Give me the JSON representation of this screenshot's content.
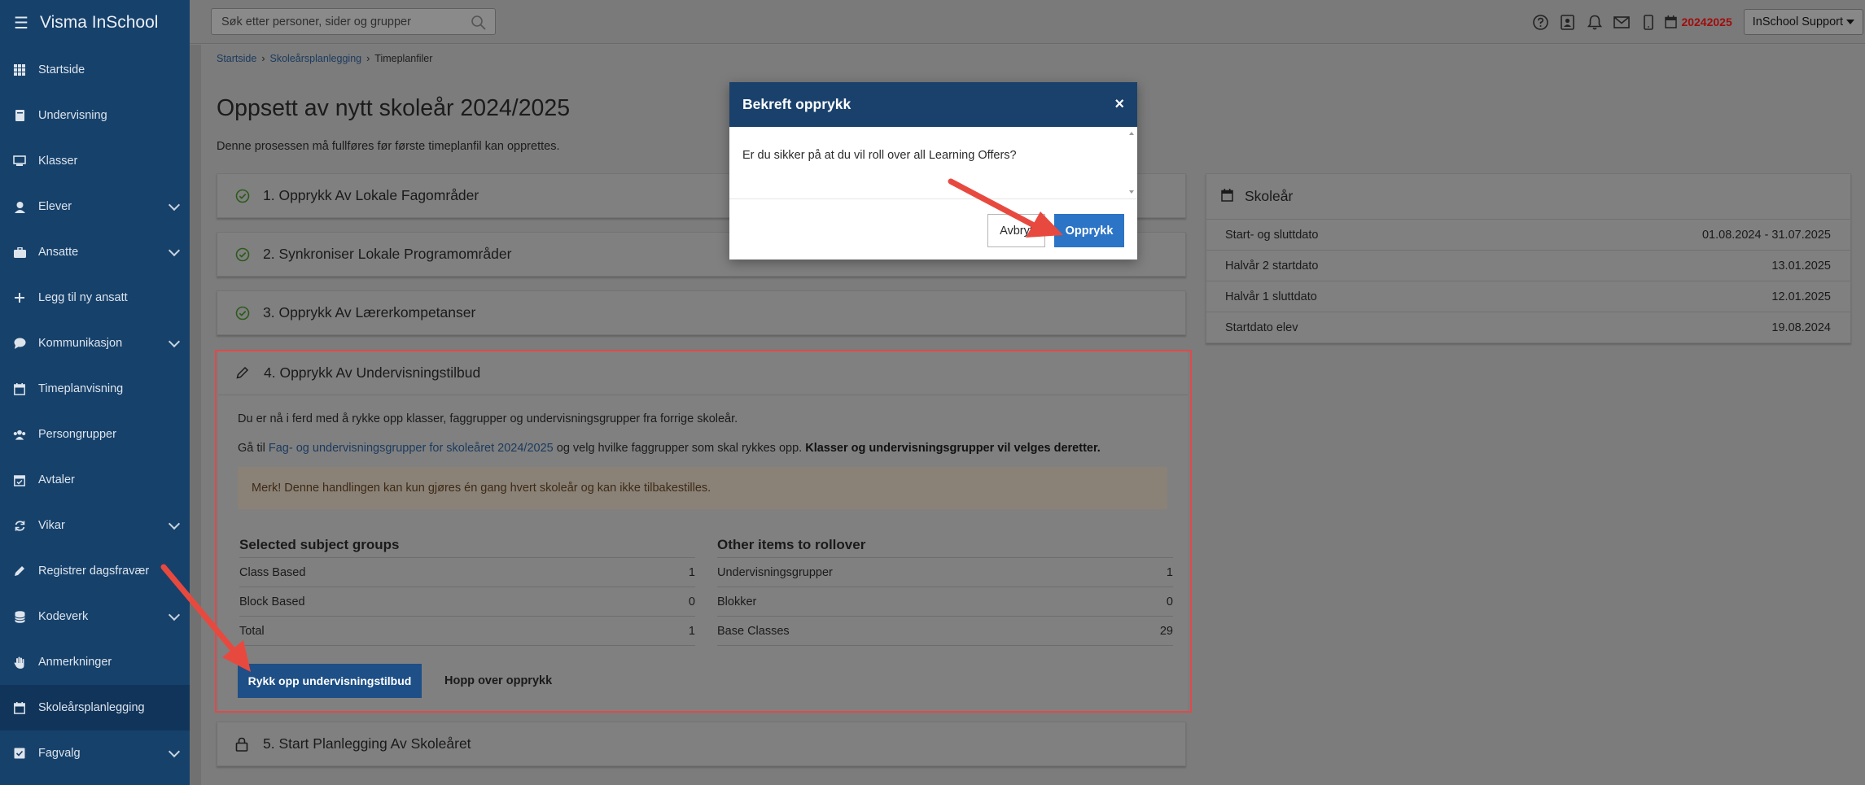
{
  "app": {
    "title": "Visma InSchool"
  },
  "sidebar": {
    "items": [
      {
        "label": "Startside",
        "icon": "grid-icon"
      },
      {
        "label": "Undervisning",
        "icon": "book-icon"
      },
      {
        "label": "Klasser",
        "icon": "presentation-icon"
      },
      {
        "label": "Elever",
        "icon": "student-icon",
        "expandable": true
      },
      {
        "label": "Ansatte",
        "icon": "briefcase-icon",
        "expandable": true
      },
      {
        "label": "Legg til ny ansatt",
        "icon": "plus-icon"
      },
      {
        "label": "Kommunikasjon",
        "icon": "chat-icon",
        "expandable": true
      },
      {
        "label": "Timeplanvisning",
        "icon": "calendar-icon"
      },
      {
        "label": "Persongrupper",
        "icon": "users-icon"
      },
      {
        "label": "Avtaler",
        "icon": "calendar-check-icon"
      },
      {
        "label": "Vikar",
        "icon": "refresh-icon",
        "expandable": true
      },
      {
        "label": "Registrer dagsfravær",
        "icon": "pencil-icon"
      },
      {
        "label": "Kodeverk",
        "icon": "database-icon",
        "expandable": true
      },
      {
        "label": "Anmerkninger",
        "icon": "hand-icon"
      },
      {
        "label": "Skoleårsplanlegging",
        "icon": "calendar-icon",
        "active": true
      },
      {
        "label": "Fagvalg",
        "icon": "book-check-icon",
        "expandable": true
      }
    ]
  },
  "topbar": {
    "search_placeholder": "Søk etter personer, sider og grupper",
    "school_year": "20242025",
    "user_menu": "InSchool Support"
  },
  "breadcrumb": [
    "Startside",
    "Skoleårsplanlegging",
    "Timeplanfiler"
  ],
  "page": {
    "title": "Oppsett av nytt skoleår 2024/2025",
    "subtitle": "Denne prosessen må fullføres før første timeplanfil kan opprettes."
  },
  "steps": [
    {
      "title": "1. Opprykk Av Lokale Fagområder",
      "status": "done"
    },
    {
      "title": "2. Synkroniser Lokale Programområder",
      "status": "done"
    },
    {
      "title": "3. Opprykk Av Lærerkompetanser",
      "status": "done"
    },
    {
      "title": "4. Opprykk Av Undervisningstilbud",
      "status": "active"
    },
    {
      "title": "5. Start Planlegging Av Skoleåret",
      "status": "locked"
    }
  ],
  "step4": {
    "intro": "Du er nå i ferd med å rykke opp klasser, faggrupper og undervisningsgrupper fra forrige skoleår.",
    "instruction_prefix": "Gå til",
    "instruction_link": "Fag- og undervisningsgrupper for skoleåret 2024/2025",
    "instruction_middle": "og velg hvilke faggrupper som skal rykkes opp.",
    "instruction_bold": "Klasser og undervisningsgrupper vil velges deretter.",
    "warning": "Merk! Denne handlingen kan kun gjøres én gang hvert skoleår og kan ikke tilbakestilles.",
    "selected": {
      "title": "Selected subject groups",
      "rows": [
        {
          "label": "Class Based",
          "value": "1"
        },
        {
          "label": "Block Based",
          "value": "0"
        },
        {
          "label": "Total",
          "value": "1"
        }
      ]
    },
    "other": {
      "title": "Other items to rollover",
      "rows": [
        {
          "label": "Undervisningsgrupper",
          "value": "1"
        },
        {
          "label": "Blokker",
          "value": "0"
        },
        {
          "label": "Base Classes",
          "value": "29"
        }
      ]
    },
    "primary_button": "Rykk opp undervisningstilbud",
    "secondary_button": "Hopp over opprykk"
  },
  "school_year_card": {
    "title": "Skoleår",
    "rows": [
      {
        "label": "Start- og sluttdato",
        "value": "01.08.2024 - 31.07.2025"
      },
      {
        "label": "Halvår 2 startdato",
        "value": "13.01.2025"
      },
      {
        "label": "Halvår 1 sluttdato",
        "value": "12.01.2025"
      },
      {
        "label": "Startdato elev",
        "value": "19.08.2024"
      }
    ]
  },
  "modal": {
    "title": "Bekreft opprykk",
    "close": "×",
    "message": "Er du sikker på at du vil roll over all Learning Offers?",
    "cancel": "Avbryt",
    "confirm": "Opprykk"
  },
  "colors": {
    "sidebar": "#16416b",
    "modal_header": "#1a416c",
    "confirm_button": "#2b74c6",
    "highlight_border": "#df4a4a",
    "annotation_arrow": "#e8493f",
    "year_text": "#a20c0c"
  }
}
